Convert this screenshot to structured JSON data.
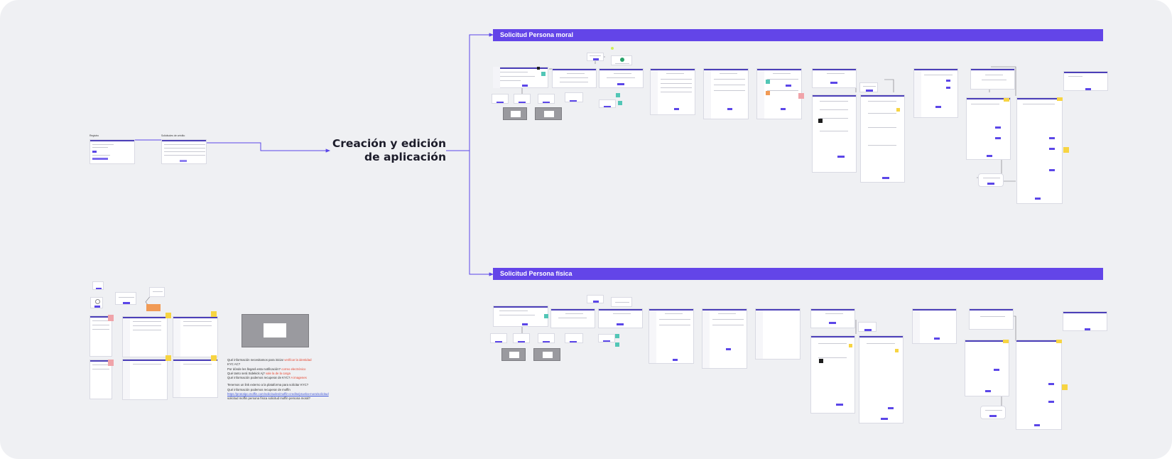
{
  "canvas": {
    "background": "#eff0f3",
    "accent": "#6345e8",
    "connector_color": "#5b46e8"
  },
  "title": {
    "line1": "Creación y edición",
    "line2": "de aplicación"
  },
  "sections": {
    "moral": {
      "label": "Solicitud Persona moral"
    },
    "fisica": {
      "label": "Solicitud Persona física"
    }
  },
  "frames": {
    "left_frame_1_label": "Registro",
    "left_frame_2_label": "Solicitudes de crédito"
  },
  "notes": {
    "q1": "Qué información necesitamos para iniciar",
    "q1_tag": "verificar la identidad",
    "q1b": "KYC AC?",
    "q2": "Por dónde les llegará esta notificación?",
    "q2_tag": "correo electrónico",
    "q3": "Qué tanto será Sidekick Aj?",
    "q3_tag": "vale la de la carga",
    "q4": "Qué información podemos recuperar de KYC?",
    "q4_tag": "A imagenes",
    "p1": "Tenemos un link externo a la plataforma para solicitar KYC?",
    "p2": "Qué información podemos recuperar de moffin",
    "p3_link": "https://prototipo.moffin.com/solicitudes/moffin-credito/prueba-mora/solicitud",
    "p4": "solicitud moffin persona física     solicitud moffin persona moral?"
  }
}
